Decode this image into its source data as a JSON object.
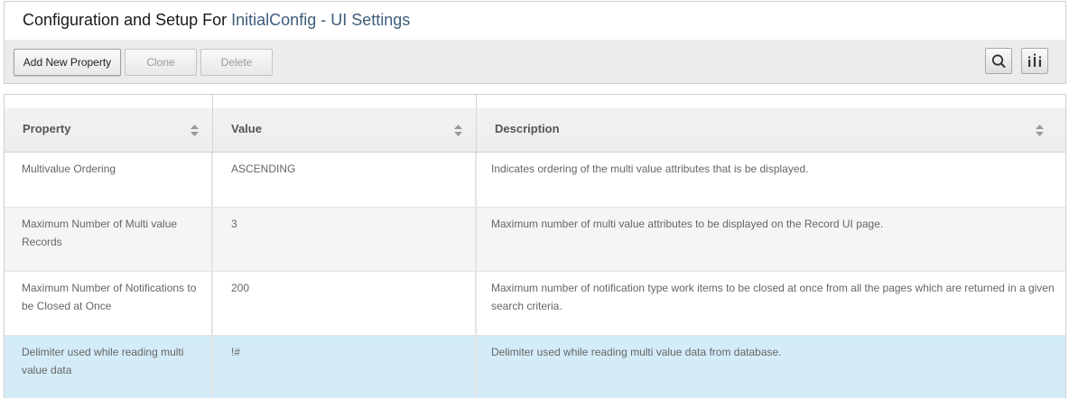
{
  "header": {
    "title_prefix": "Configuration and Setup For ",
    "title_context": "InitialConfig - UI Settings"
  },
  "toolbar": {
    "add_label": "Add New Property",
    "clone_label": "Clone",
    "delete_label": "Delete",
    "search_icon": "search-icon",
    "columns_icon": "columns-icon"
  },
  "table": {
    "columns": [
      "Property",
      "Value",
      "Description"
    ],
    "rows": [
      {
        "property": "Multivalue Ordering",
        "value": "ASCENDING",
        "description": "Indicates ordering of the multi value attributes that is be displayed."
      },
      {
        "property": "Maximum Number of Multi value Records",
        "value": "3",
        "description": "Maximum number of multi value attributes to be displayed on the Record UI page."
      },
      {
        "property": "Maximum Number of Notifications to be Closed at Once",
        "value": "200",
        "description": "Maximum number of notification type work items to be closed at once from all the pages which are returned in a given search criteria."
      },
      {
        "property": "Delimiter used while reading multi value data",
        "value": "!#",
        "description": "Delimiter used while reading multi value data from database.",
        "selected": true
      }
    ]
  },
  "colors": {
    "title_accent": "#3d5c7a",
    "selected_row": "#d4ecf8",
    "alt_row": "#f5f5f5"
  }
}
